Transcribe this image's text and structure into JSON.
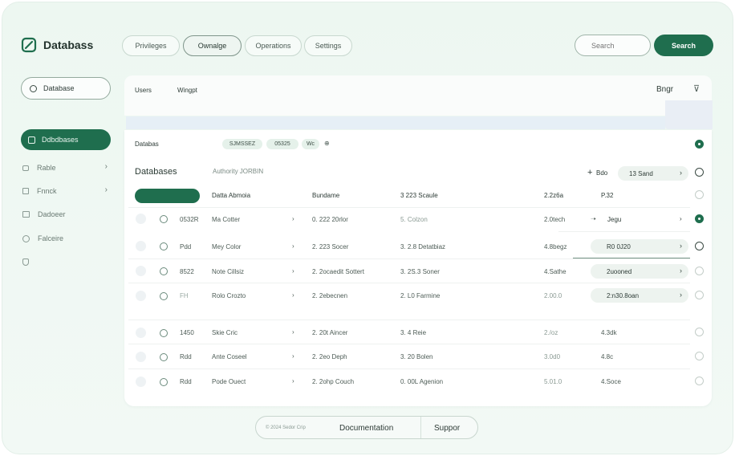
{
  "brand": {
    "name": "Databass",
    "icon": "leaf-logo-icon"
  },
  "nav_tabs": [
    "Privileges",
    "Ownalge",
    "Operations",
    "Settings"
  ],
  "search": {
    "placeholder": "Search",
    "button_label": "Search"
  },
  "sidebar": {
    "db_select": "Database",
    "active_item": "Ddbdbases",
    "items": [
      "Rable",
      "Fnnck",
      "Dadoeer",
      "Falceire"
    ]
  },
  "panel_header": {
    "col1": "Users",
    "col2": "Wingpt",
    "right_label": "Bngr"
  },
  "section_row": {
    "label": "Databas",
    "chip1": "SJMSSEZ",
    "chip2": "05325",
    "chip3": "Wc",
    "extra": "⊕"
  },
  "title_row": {
    "title": "Databases",
    "subtitle": "Authority JORBIN",
    "add_label": "Bdo",
    "select_label": "13 Sand"
  },
  "table_head": [
    "Datta Abmoia",
    "Bundame",
    "3  223 Scaule",
    "2.2z6a",
    "P.32"
  ],
  "rows": [
    [
      "0532R",
      "Ma Cotter",
      "›",
      "0.  222 20rlor",
      "5. Colzon",
      "2.0tech",
      "Jegu"
    ],
    [
      "Pdd",
      "Mey Color",
      "›",
      "2.  223 Socer",
      "3. 2.8 Detatbiaz",
      "4.8begz",
      "R0 0J20"
    ],
    [
      "8522",
      "Note Cillsiz",
      "›",
      "2.  2ocaedit Sottert",
      "3. 2S.3 Soner",
      "4.Sathe",
      "2uooned"
    ],
    [
      "FH",
      "Rolo Crozto",
      "›",
      "2.  2ebecnen",
      "2. L0 Farmine",
      "2.00.0",
      "2:n30.8oan"
    ],
    [
      "1450",
      "Skie Cric",
      "›",
      "2.  20t Aincer",
      "3. 4 Reie",
      "2./oz",
      "4.3dk"
    ],
    [
      "Rdd",
      "Ante Coseel",
      "›",
      "2.  2eo Deph",
      "3. 20 Bolen",
      "3.0d0",
      "4.8c"
    ],
    [
      "Rdd",
      "Pode Ouect",
      "›",
      "2.  2ohp Couch",
      "0. 00L Agenion",
      "5.01.0",
      "4.Soce"
    ]
  ],
  "footer": {
    "copyright": "© 2024 Sedor Crip",
    "documentation": "Documentation",
    "support": "Suppor"
  },
  "colors": {
    "accent": "#1f6e4e",
    "bg": "#edf7f1"
  }
}
